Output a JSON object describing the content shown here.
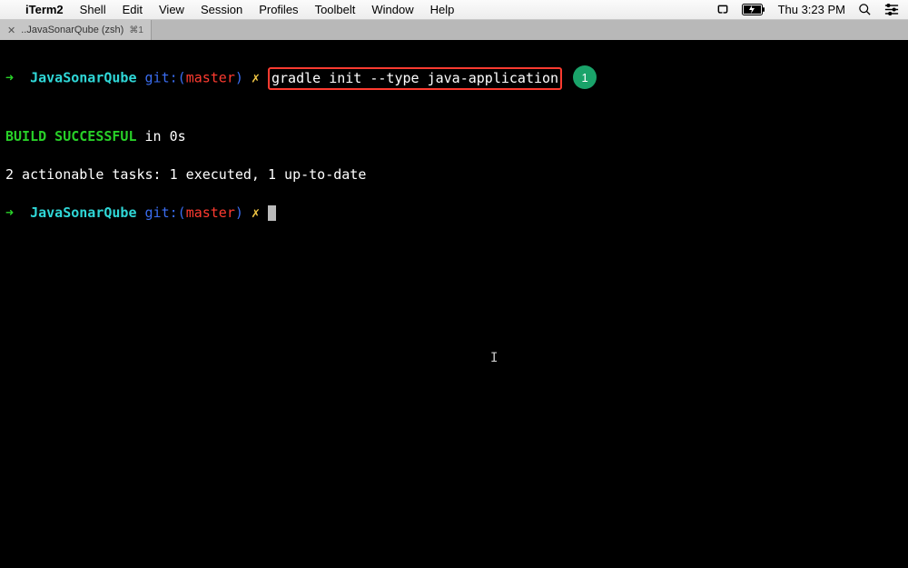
{
  "menubar": {
    "app_name": "iTerm2",
    "items": [
      "Shell",
      "Edit",
      "View",
      "Session",
      "Profiles",
      "Toolbelt",
      "Window",
      "Help"
    ],
    "clock": "Thu 3:23 PM"
  },
  "tab": {
    "label": "..JavaSonarQube (zsh)",
    "shortcut": "⌘1",
    "close": "✕"
  },
  "terminal": {
    "prompt_arrow": "➜",
    "dir": "JavaSonarQube",
    "git_prefix": "git:(",
    "branch": "master",
    "git_suffix": ")",
    "dirty": "✗",
    "command": "gradle init --type java-application",
    "badge_num": "1",
    "build_msg": "BUILD SUCCESSFUL",
    "build_time": " in 0s",
    "tasks_msg": "2 actionable tasks: 1 executed, 1 up-to-date"
  }
}
